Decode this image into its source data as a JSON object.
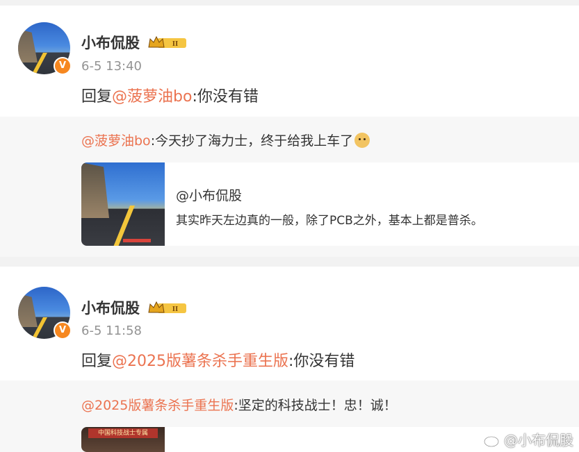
{
  "posts": [
    {
      "username": "小布侃股",
      "level_badge": "II",
      "verified_badge": "V",
      "timestamp": "6-5 13:40",
      "reply_prefix": "回复",
      "reply_mention": "@菠萝油bo",
      "reply_text": ":你没有错",
      "quote_mention": "@菠萝油bo",
      "quote_text": ":今天抄了海力士，终于给我上车了",
      "quote_emoji": "doge-emoji",
      "card": {
        "user": "@小布侃股",
        "desc": "其实昨天左边真的一般，除了PCB之外，基本上都是普杀。"
      }
    },
    {
      "username": "小布侃股",
      "level_badge": "II",
      "verified_badge": "V",
      "timestamp": "6-5 11:58",
      "reply_prefix": "回复",
      "reply_mention": "@2025版薯条杀手重生版",
      "reply_text": ":你没有错",
      "quote_mention": "@2025版薯条杀手重生版",
      "quote_text": ":坚定的科技战士！忠！诚！",
      "card": {
        "image_caption": "中国科技战士专属"
      }
    }
  ],
  "watermark": "@小布侃股",
  "colors": {
    "mention": "#eb7350",
    "separator": "#f2f2f2",
    "quote_background": "#f7f7f7",
    "verified": "#f6871f"
  }
}
